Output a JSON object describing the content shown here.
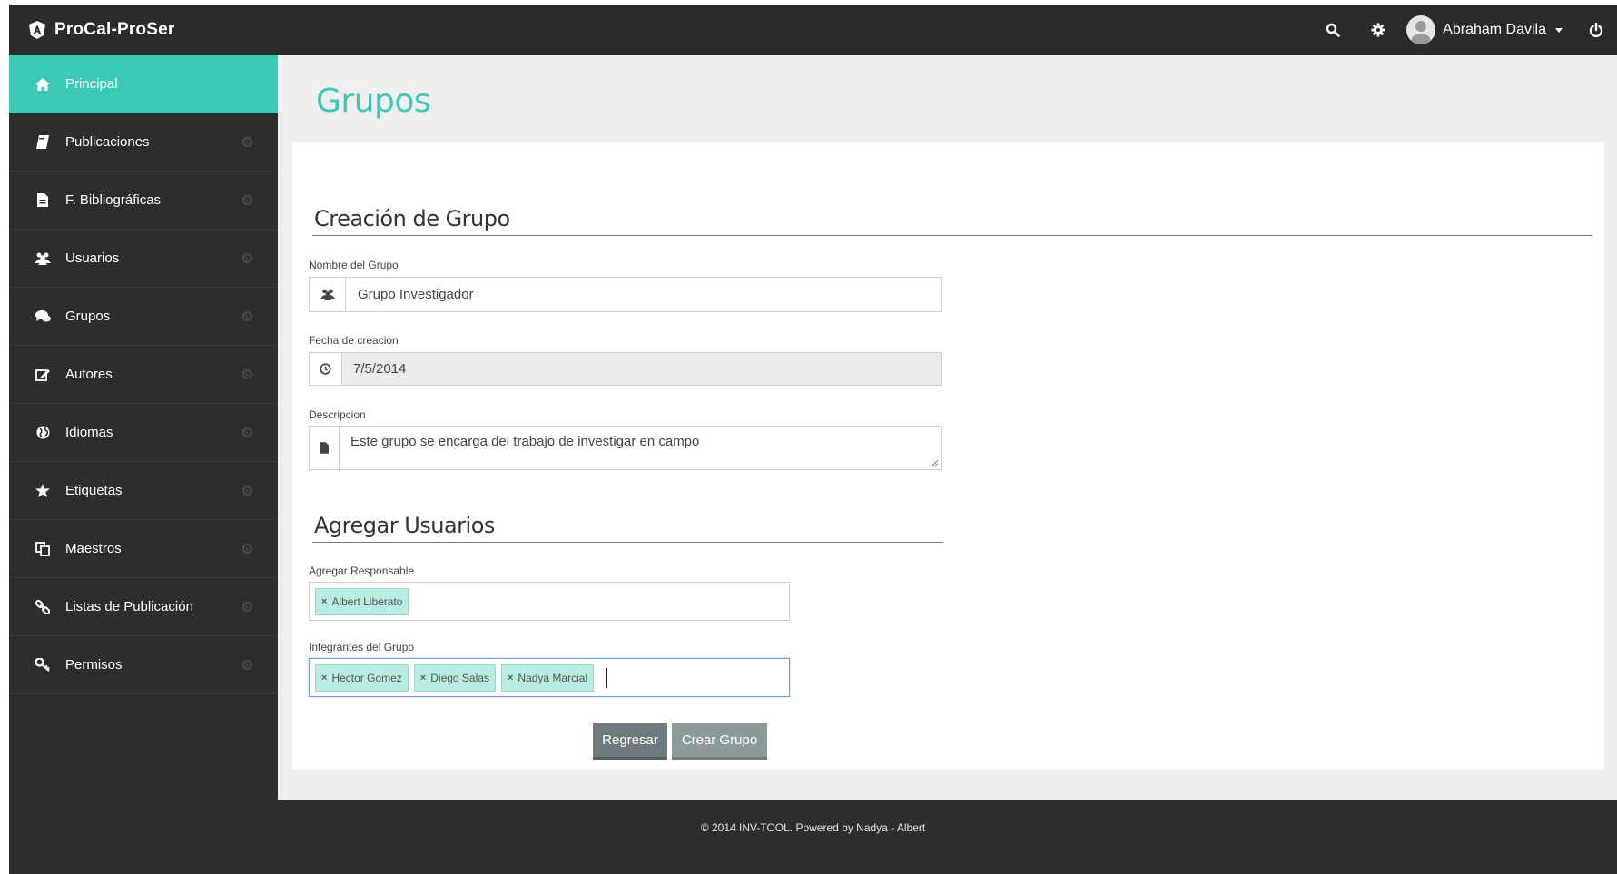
{
  "app": {
    "brand": "ProCal-ProSer"
  },
  "topbar": {
    "user_name": "Abraham Davila",
    "icons": [
      "search-icon",
      "gear-icon",
      "user-avatar",
      "power-icon"
    ]
  },
  "sidebar": {
    "items": [
      {
        "label": "Principal",
        "icon": "home-icon",
        "active": true
      },
      {
        "label": "Publicaciones",
        "icon": "book-icon"
      },
      {
        "label": "F. Bibliográficas",
        "icon": "file-icon"
      },
      {
        "label": "Usuarios",
        "icon": "users-icon"
      },
      {
        "label": "Grupos",
        "icon": "comments-icon"
      },
      {
        "label": "Autores",
        "icon": "edit-icon"
      },
      {
        "label": "Idiomas",
        "icon": "globe-icon"
      },
      {
        "label": "Etiquetas",
        "icon": "star-icon"
      },
      {
        "label": "Maestros",
        "icon": "copy-icon"
      },
      {
        "label": "Listas de Publicación",
        "icon": "link-icon"
      },
      {
        "label": "Permisos",
        "icon": "key-icon"
      }
    ]
  },
  "main": {
    "page_title": "Grupos",
    "section_create": "Creación de Grupo",
    "group_name": {
      "label": "Nombre del Grupo",
      "value": "Grupo Investigador"
    },
    "creation_date": {
      "label": "Fecha de creacion",
      "value": "7/5/2014"
    },
    "description": {
      "label": "Descripcion",
      "value": "Este grupo se encarga del trabajo de investigar en campo"
    },
    "section_users": "Agregar Usuarios",
    "responsible": {
      "label": "Agregar Responsable",
      "tags": [
        "Albert Liberato"
      ]
    },
    "members": {
      "label": "Integrantes del Grupo",
      "tags": [
        "Hector Gomez",
        "Diego Salas",
        "Nadya Marcial"
      ]
    },
    "buttons": {
      "back": "Regresar",
      "create": "Crear Grupo"
    }
  },
  "footer": {
    "text": "© 2014 INV-TOOL. Powered by Nadya - Albert"
  },
  "colors": {
    "accent": "#3cc9b5",
    "dark": "#2d2d2d",
    "content_bg": "#efefef",
    "tag_bg": "#b9ece3"
  }
}
